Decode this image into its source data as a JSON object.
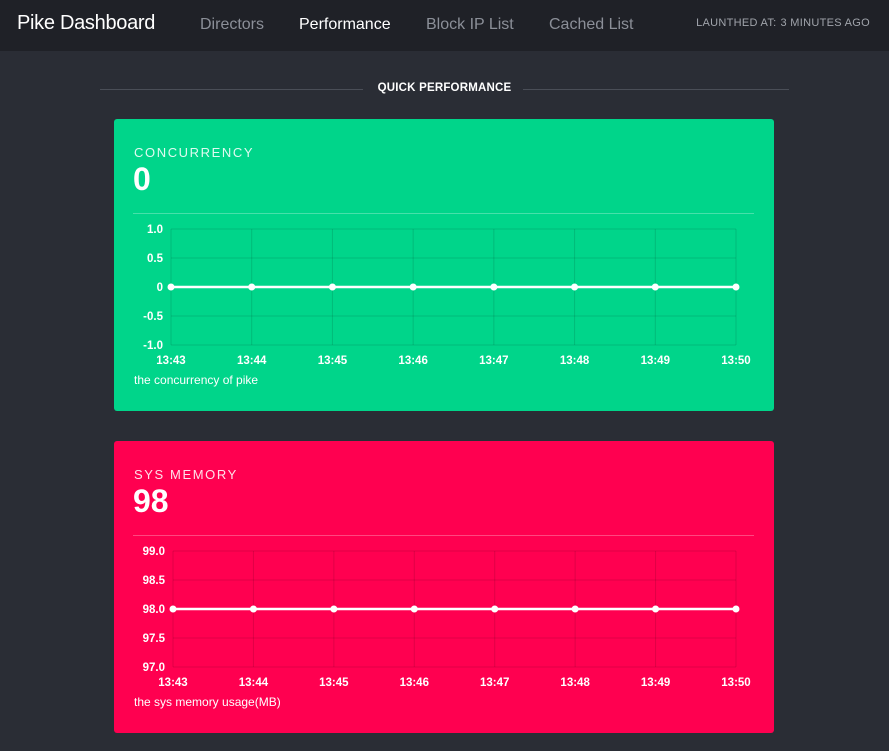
{
  "app": {
    "title": "Pike Dashboard"
  },
  "nav": {
    "items": [
      {
        "label": "Directors",
        "active": false
      },
      {
        "label": "Performance",
        "active": true
      },
      {
        "label": "Block IP List",
        "active": false
      },
      {
        "label": "Cached List",
        "active": false
      }
    ]
  },
  "launch": {
    "label": "LAUNTHED AT:",
    "value": "3 MINUTES AGO"
  },
  "section": {
    "title": "QUICK PERFORMANCE"
  },
  "colors": {
    "topbar": "#1f2127",
    "background": "#2a2d35",
    "concurrency_card": "#00d58a",
    "memory_card": "#ff0050"
  },
  "cards": [
    {
      "title": "CONCURRENCY",
      "value": "0",
      "description": "the concurrency of pike"
    },
    {
      "title": "SYS MEMORY",
      "value": "98",
      "description": "the sys memory usage(MB)"
    }
  ],
  "chart_data": [
    {
      "type": "line",
      "x": [
        "13:43",
        "13:44",
        "13:45",
        "13:46",
        "13:47",
        "13:48",
        "13:49",
        "13:50"
      ],
      "series": [
        {
          "values": [
            0,
            0,
            0,
            0,
            0,
            0,
            0,
            0
          ]
        }
      ],
      "yticks": [
        "1.0",
        "0.5",
        "0",
        "-0.5",
        "-1.0"
      ],
      "ylim": [
        -1.0,
        1.0
      ],
      "grid": true
    },
    {
      "type": "line",
      "x": [
        "13:43",
        "13:44",
        "13:45",
        "13:46",
        "13:47",
        "13:48",
        "13:49",
        "13:50"
      ],
      "series": [
        {
          "values": [
            98,
            98,
            98,
            98,
            98,
            98,
            98,
            98
          ]
        }
      ],
      "yticks": [
        "99.0",
        "98.5",
        "98.0",
        "97.5",
        "97.0"
      ],
      "ylim": [
        97.0,
        99.0
      ],
      "grid": true
    }
  ]
}
